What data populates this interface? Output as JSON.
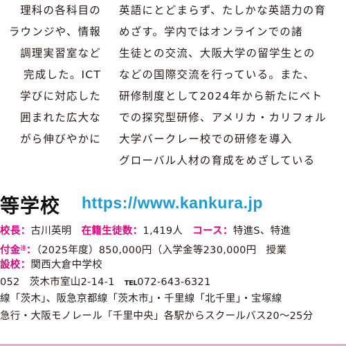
{
  "intro_left": [
    "理科の各科目の",
    "ラウンジや、情報",
    "調理実習室など",
    "完成した。ICT",
    "学びに対応した",
    "囲まれた広大な",
    "がら伸びやかに"
  ],
  "intro_right": [
    "英語にとどまらず、たしかな英語力の育",
    "めざす。学内ではオンラインでの諸",
    "生徒との交流、大阪大学の留学生との",
    "などの国際交流を行っている。また、",
    "研修制度として2024年から新たにベト",
    "での探究型研修、アメリカ・カリフォル",
    "大学バークレー校での研修を導入",
    "グローバル人材の育成をめざしている"
  ],
  "school": {
    "name": "等学校",
    "website": "https://www.kankura.jp"
  },
  "info": {
    "principal_label": "校長：",
    "principal_value": "古川英明",
    "students_label": "在籍生徒数：",
    "students_value": "1,419人",
    "course_label": "コース：",
    "course_value": "特進S、特進",
    "fee_label": "付金",
    "fee_note": "注",
    "fee_colon": "：",
    "fee_value": "（2025年度）850,000円（入学金等230,000円",
    "fee_tail": "授業",
    "junior_label": "設校：",
    "junior_value": "関西大倉中学校",
    "postal": "052",
    "address": "茨木市室山2-14-1",
    "tel_mark": "TEL",
    "tel_value": "072-643-6321",
    "access_line1": "線「茨木」、阪急京都線「茨木市」・千里線「北千里」・宝塚線",
    "access_line2": "急行・大阪モノレール「千里中央」各駅からスクールバス20～25分"
  },
  "colors": {
    "accent_pink": "#e4007f",
    "link_blue": "#1b9ad6",
    "text": "#231815"
  }
}
